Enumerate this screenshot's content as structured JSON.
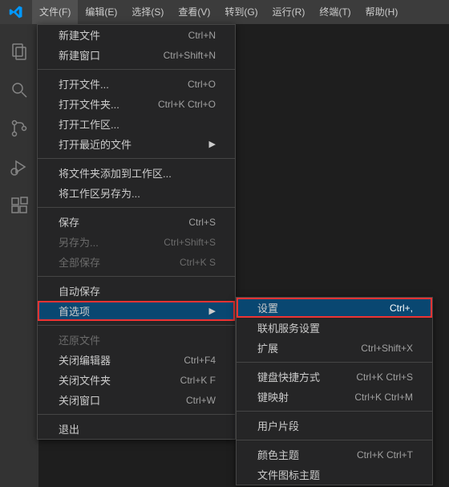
{
  "menubar": {
    "items": [
      {
        "label": "文件(F)",
        "active": true
      },
      {
        "label": "编辑(E)"
      },
      {
        "label": "选择(S)"
      },
      {
        "label": "查看(V)"
      },
      {
        "label": "转到(G)"
      },
      {
        "label": "运行(R)"
      },
      {
        "label": "终端(T)"
      },
      {
        "label": "帮助(H)"
      }
    ]
  },
  "file_menu": [
    {
      "label": "新建文件",
      "shortcut": "Ctrl+N"
    },
    {
      "label": "新建窗口",
      "shortcut": "Ctrl+Shift+N"
    },
    {
      "sep": true
    },
    {
      "label": "打开文件...",
      "shortcut": "Ctrl+O"
    },
    {
      "label": "打开文件夹...",
      "shortcut": "Ctrl+K Ctrl+O"
    },
    {
      "label": "打开工作区..."
    },
    {
      "label": "打开最近的文件",
      "submenu": true
    },
    {
      "sep": true
    },
    {
      "label": "将文件夹添加到工作区..."
    },
    {
      "label": "将工作区另存为..."
    },
    {
      "sep": true
    },
    {
      "label": "保存",
      "shortcut": "Ctrl+S"
    },
    {
      "label": "另存为...",
      "shortcut": "Ctrl+Shift+S",
      "disabled": true
    },
    {
      "label": "全部保存",
      "shortcut": "Ctrl+K S",
      "disabled": true
    },
    {
      "sep": true
    },
    {
      "label": "自动保存"
    },
    {
      "label": "首选项",
      "submenu": true,
      "highlight": true
    },
    {
      "sep": true
    },
    {
      "label": "还原文件",
      "disabled": true
    },
    {
      "label": "关闭编辑器",
      "shortcut": "Ctrl+F4"
    },
    {
      "label": "关闭文件夹",
      "shortcut": "Ctrl+K F"
    },
    {
      "label": "关闭窗口",
      "shortcut": "Ctrl+W"
    },
    {
      "sep": true
    },
    {
      "label": "退出"
    }
  ],
  "pref_menu": [
    {
      "label": "设置",
      "shortcut": "Ctrl+,",
      "highlight": true
    },
    {
      "label": "联机服务设置"
    },
    {
      "label": "扩展",
      "shortcut": "Ctrl+Shift+X"
    },
    {
      "sep": true
    },
    {
      "label": "键盘快捷方式",
      "shortcut": "Ctrl+K Ctrl+S"
    },
    {
      "label": "键映射",
      "shortcut": "Ctrl+K Ctrl+M"
    },
    {
      "sep": true
    },
    {
      "label": "用户片段"
    },
    {
      "sep": true
    },
    {
      "label": "颜色主题",
      "shortcut": "Ctrl+K Ctrl+T"
    },
    {
      "label": "文件图标主题"
    }
  ],
  "arrow": "▶"
}
